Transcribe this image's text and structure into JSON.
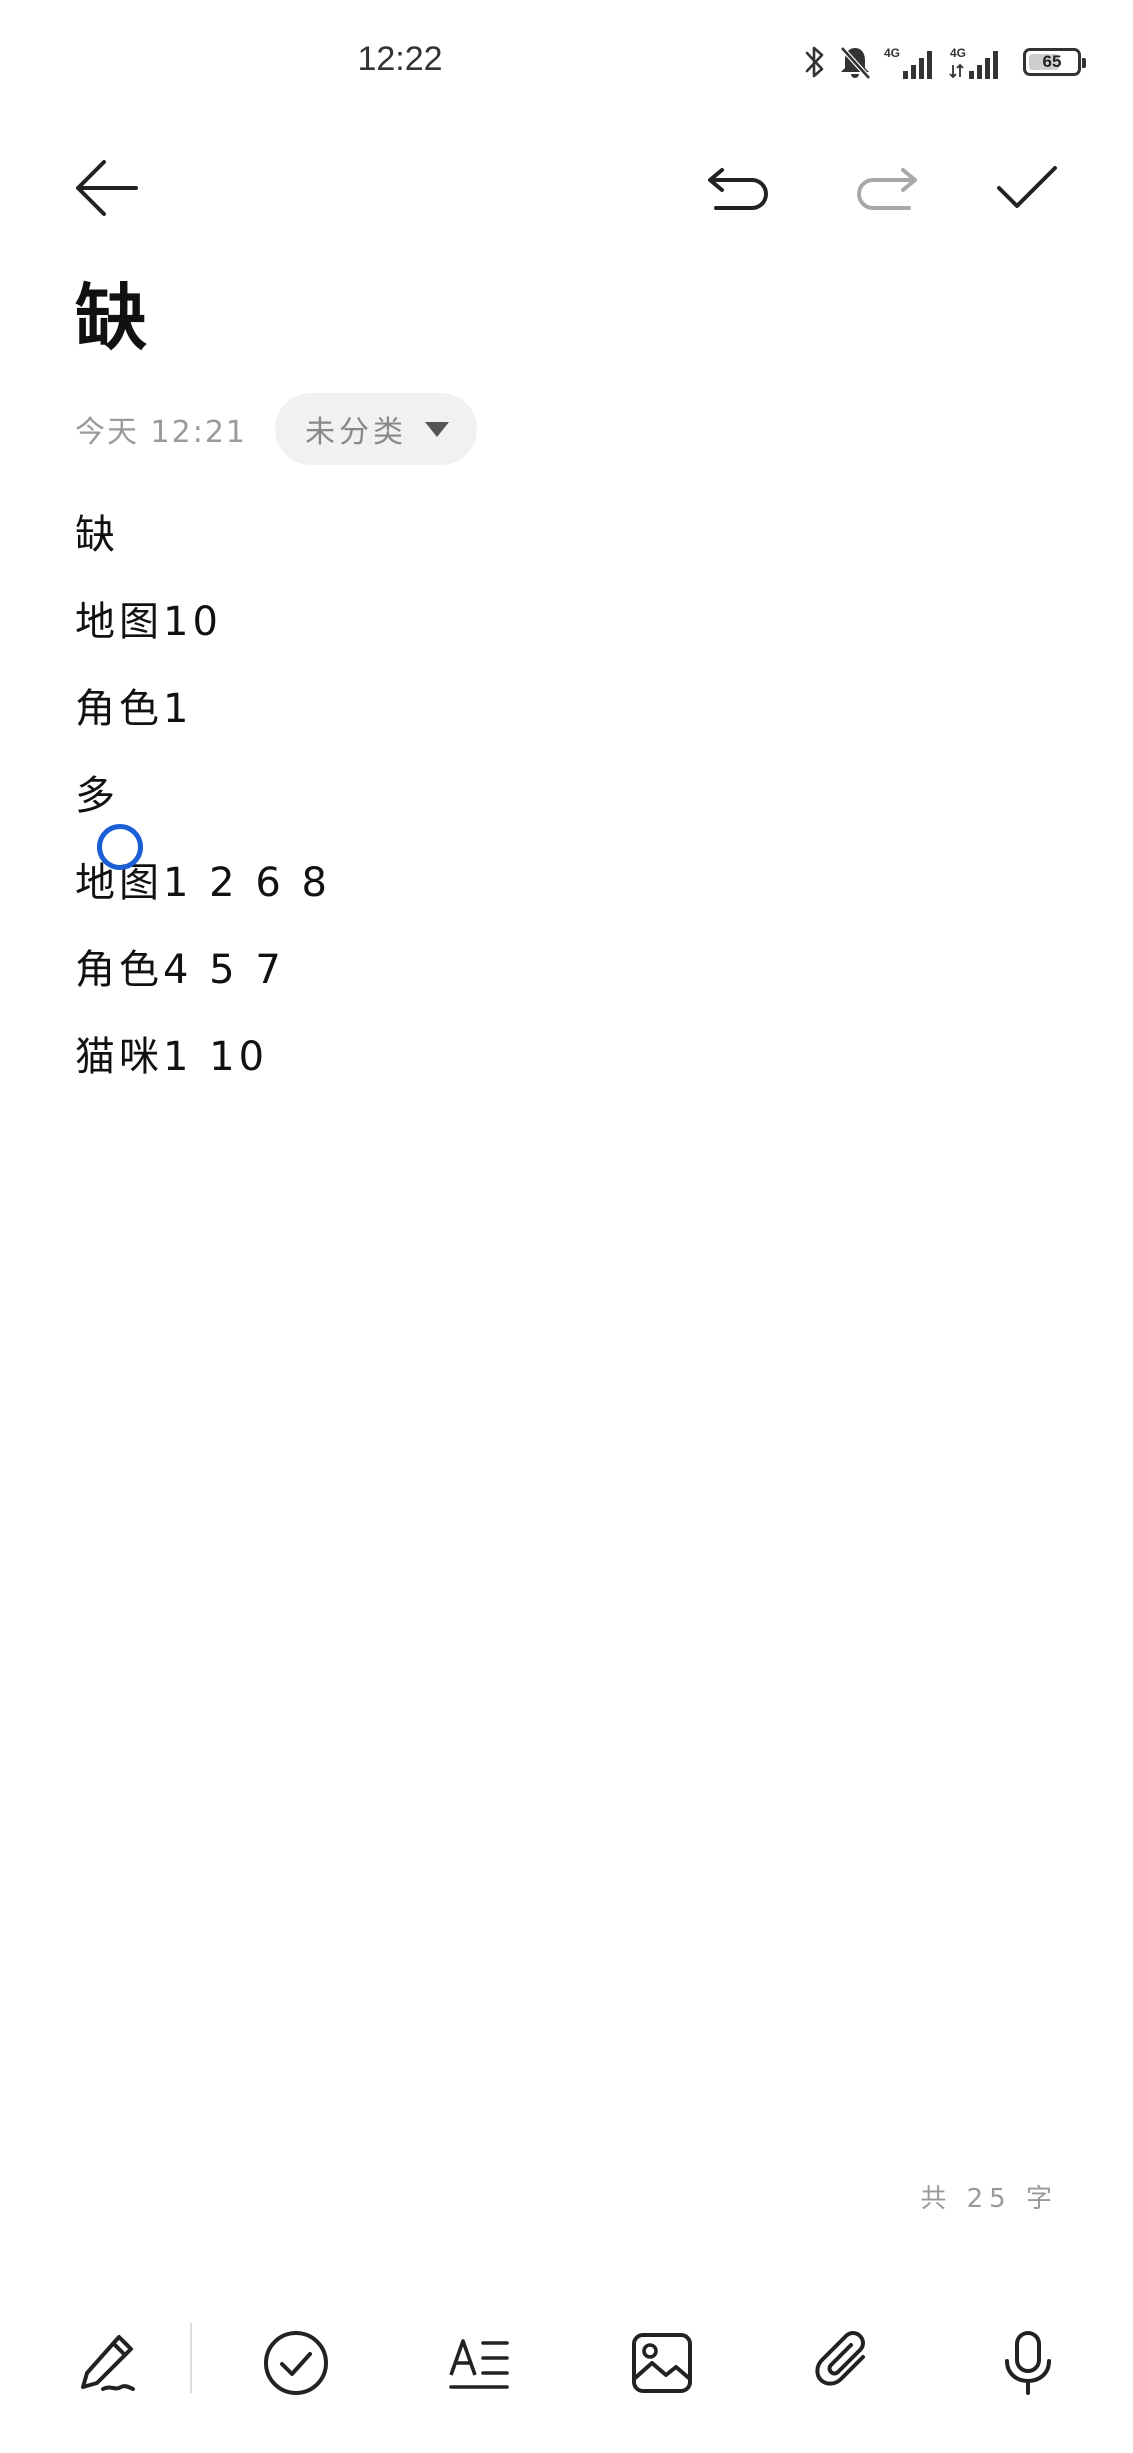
{
  "status_bar": {
    "time": "12:22",
    "battery": "65",
    "battery_level": 0.65,
    "network_1": "4G",
    "network_2": "4G"
  },
  "note": {
    "title": "缺",
    "date": "今天 12:21",
    "category": "未分类",
    "lines": [
      "缺",
      "地图10",
      "角色1",
      "多",
      "地图1 2 6 8",
      "角色4 5 7",
      "猫咪1 10"
    ],
    "word_count": "共 25 字"
  },
  "icons": {
    "back": "arrow-left-icon",
    "undo": "undo-icon",
    "redo": "redo-icon",
    "done": "checkmark-icon",
    "handwriting": "pen-icon",
    "checklist": "check-circle-icon",
    "format": "text-format-icon",
    "image": "image-icon",
    "attachment": "paperclip-icon",
    "voice": "microphone-icon"
  },
  "colors": {
    "cursor": "#1a5fd6",
    "redo_disabled": "#a8a8a8"
  }
}
